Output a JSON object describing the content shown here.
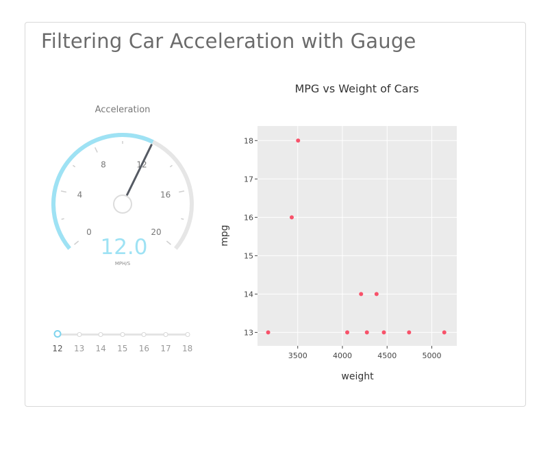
{
  "page": {
    "title": "Filtering Car Acceleration with Gauge"
  },
  "gauge": {
    "title": "Acceleration",
    "value": 12.0,
    "display_value": "12.0",
    "units": "MPH/S",
    "min": 0,
    "max": 20,
    "major_ticks": [
      "0",
      "4",
      "8",
      "12",
      "16",
      "20"
    ],
    "colors": {
      "fill": "#9ee2f4",
      "track": "#e6e6e6",
      "needle": "#555a63",
      "value_text": "#9ee2f4"
    }
  },
  "slider": {
    "value": 12,
    "marks": [
      "12",
      "13",
      "14",
      "15",
      "16",
      "17",
      "18"
    ],
    "colors": {
      "handle": "#7fd4ee"
    }
  },
  "chart_data": {
    "type": "scatter",
    "title": "MPG vs Weight of Cars",
    "xlabel": "weight",
    "ylabel": "mpg",
    "xlim": [
      3050,
      5280
    ],
    "ylim": [
      12.65,
      18.38
    ],
    "xticks": [
      3500,
      4000,
      4500,
      5000
    ],
    "xtick_labels": [
      "3500",
      "4000",
      "4500",
      "5000"
    ],
    "yticks": [
      13,
      14,
      15,
      16,
      17,
      18
    ],
    "ytick_labels": [
      "13",
      "14",
      "15",
      "16",
      "17",
      "18"
    ],
    "grid": true,
    "legend": "none",
    "colors": {
      "marker": "#f8526a",
      "plot_bg": "#ebebeb",
      "grid": "#ffffff"
    },
    "points": [
      {
        "x": 3504,
        "y": 18
      },
      {
        "x": 3433,
        "y": 16
      },
      {
        "x": 4209,
        "y": 14
      },
      {
        "x": 4382,
        "y": 14
      },
      {
        "x": 3169,
        "y": 13
      },
      {
        "x": 4054,
        "y": 13
      },
      {
        "x": 4274,
        "y": 13
      },
      {
        "x": 4464,
        "y": 13
      },
      {
        "x": 4746,
        "y": 13
      },
      {
        "x": 5140,
        "y": 13
      }
    ]
  }
}
